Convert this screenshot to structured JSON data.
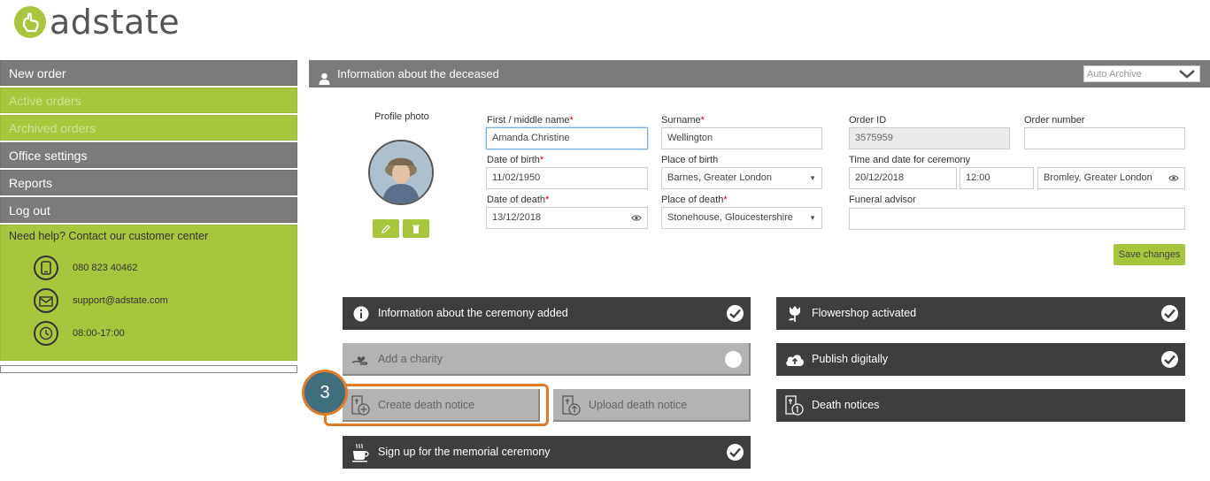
{
  "brand": {
    "name": "adstate",
    "accent": "#a7c53d"
  },
  "sidebar": {
    "items": [
      {
        "label": "New order",
        "state": "default"
      },
      {
        "label": "Active orders",
        "state": "green"
      },
      {
        "label": "Archived orders",
        "state": "green"
      },
      {
        "label": "Office settings",
        "state": "default"
      },
      {
        "label": "Reports",
        "state": "default"
      },
      {
        "label": "Log out",
        "state": "default"
      }
    ],
    "help": {
      "title": "Need help? Contact our customer center",
      "phone": "080 823 40462",
      "email": "support@adstate.com",
      "hours": "08:00-17:00"
    }
  },
  "header": {
    "title": "Information about the deceased",
    "archive_select": "Auto Archive"
  },
  "profile": {
    "label": "Profile photo"
  },
  "form": {
    "first_name": {
      "label": "First / middle name",
      "value": "Amanda Christine"
    },
    "surname": {
      "label": "Surname",
      "value": "Wellington"
    },
    "order_id": {
      "label": "Order ID",
      "value": "3575959"
    },
    "order_number": {
      "label": "Order number",
      "value": ""
    },
    "dob": {
      "label": "Date of birth",
      "value": "11/02/1950"
    },
    "pob": {
      "label": "Place of birth",
      "value": "Barnes, Greater London"
    },
    "ceremony": {
      "label": "Time and date for ceremony",
      "date": "20/12/2018",
      "time": "12:00",
      "place": "Bromley, Greater London"
    },
    "dod": {
      "label": "Date of death",
      "value": "13/12/2018"
    },
    "pod": {
      "label": "Place of death",
      "value": "Stonehouse, Gloucestershire"
    },
    "advisor": {
      "label": "Funeral advisor",
      "value": ""
    },
    "save_label": "Save changes"
  },
  "actions": {
    "ceremony_info": "Information about the ceremony added",
    "charity": "Add a charity",
    "create_notice": "Create death notice",
    "upload_notice": "Upload death notice",
    "memorial": "Sign up for the memorial ceremony",
    "flowershop": "Flowershop activated",
    "publish": "Publish digitally",
    "death_notices": "Death notices"
  },
  "annotation": {
    "step": "3",
    "color": "#e07b2a"
  }
}
